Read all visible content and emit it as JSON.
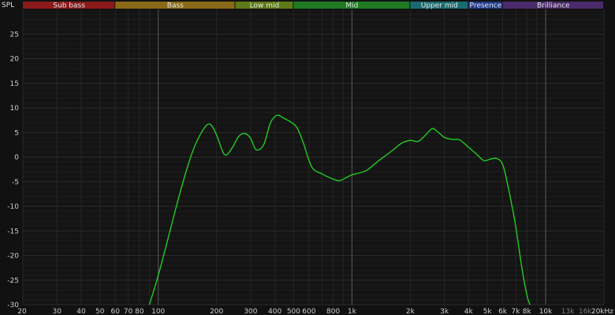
{
  "chart_data": {
    "type": "line",
    "ylabel": "SPL",
    "xscale": "log",
    "xlim": [
      20,
      20000
    ],
    "ylim": [
      -30,
      30
    ],
    "grid": true,
    "y_ticks": [
      {
        "value": 25,
        "label": "25"
      },
      {
        "value": 20,
        "label": "20"
      },
      {
        "value": 15,
        "label": "15"
      },
      {
        "value": 10,
        "label": "10"
      },
      {
        "value": 5,
        "label": "5"
      },
      {
        "value": 0,
        "label": "0"
      },
      {
        "value": -5,
        "label": "-5"
      },
      {
        "value": -10,
        "label": "-10"
      },
      {
        "value": -15,
        "label": "-15"
      },
      {
        "value": -20,
        "label": "-20"
      },
      {
        "value": -25,
        "label": "-25"
      },
      {
        "value": -30,
        "label": "-30"
      }
    ],
    "x_ticks": [
      {
        "value": 20,
        "label": "20"
      },
      {
        "value": 30,
        "label": "30"
      },
      {
        "value": 40,
        "label": "40"
      },
      {
        "value": 50,
        "label": "50"
      },
      {
        "value": 60,
        "label": "60"
      },
      {
        "value": 70,
        "label": "70"
      },
      {
        "value": 80,
        "label": "80"
      },
      {
        "value": 100,
        "label": "100"
      },
      {
        "value": 200,
        "label": "200"
      },
      {
        "value": 300,
        "label": "300"
      },
      {
        "value": 400,
        "label": "400"
      },
      {
        "value": 500,
        "label": "500"
      },
      {
        "value": 600,
        "label": "600"
      },
      {
        "value": 800,
        "label": "800"
      },
      {
        "value": 1000,
        "label": "1k"
      },
      {
        "value": 2000,
        "label": "2k"
      },
      {
        "value": 3000,
        "label": "3k"
      },
      {
        "value": 4000,
        "label": "4k"
      },
      {
        "value": 5000,
        "label": "5k"
      },
      {
        "value": 6000,
        "label": "6k"
      },
      {
        "value": 7000,
        "label": "7k"
      },
      {
        "value": 8000,
        "label": "8k"
      },
      {
        "value": 10000,
        "label": "10k"
      },
      {
        "value": 13000,
        "label": "13k",
        "dim": true
      },
      {
        "value": 16000,
        "label": "16k",
        "dim": true
      },
      {
        "value": 20000,
        "label": "20kHz"
      }
    ],
    "major_grid_x": [
      100,
      1000,
      10000
    ],
    "bands": [
      {
        "name": "Sub bass",
        "from": 20,
        "to": 60,
        "color": "#8b1a1a"
      },
      {
        "name": "Bass",
        "from": 60,
        "to": 250,
        "color": "#8a6a16"
      },
      {
        "name": "Low mid",
        "from": 250,
        "to": 500,
        "color": "#5e7a16"
      },
      {
        "name": "Mid",
        "from": 500,
        "to": 2000,
        "color": "#1f7a22"
      },
      {
        "name": "Upper mid",
        "from": 2000,
        "to": 4000,
        "color": "#1a6b70"
      },
      {
        "name": "Presence",
        "from": 4000,
        "to": 6000,
        "color": "#1f3a8a"
      },
      {
        "name": "Brilliance",
        "from": 6000,
        "to": 20000,
        "color": "#4a2a6a"
      }
    ],
    "series": [
      {
        "color": "#22cc22",
        "x": [
          90,
          100,
          115,
          130,
          150,
          170,
          185,
          200,
          220,
          240,
          260,
          280,
          300,
          320,
          350,
          380,
          410,
          440,
          480,
          520,
          560,
          620,
          700,
          780,
          860,
          930,
          1000,
          1100,
          1200,
          1300,
          1400,
          1600,
          1800,
          2000,
          2200,
          2400,
          2600,
          2800,
          3000,
          3300,
          3600,
          4000,
          4400,
          4800,
          5200,
          5600,
          6000,
          6400,
          7000,
          7500,
          8000,
          8300
        ],
        "y": [
          -30,
          -24,
          -15,
          -7,
          1,
          5.5,
          6.7,
          4.5,
          0.5,
          1.8,
          4.2,
          4.8,
          3.8,
          1.5,
          2.5,
          7.0,
          8.5,
          8.0,
          7.2,
          6.0,
          3.0,
          -2.0,
          -3.4,
          -4.3,
          -4.8,
          -4.2,
          -3.6,
          -3.2,
          -2.6,
          -1.5,
          -0.5,
          1.2,
          2.8,
          3.4,
          3.2,
          4.5,
          5.8,
          5.0,
          4.0,
          3.6,
          3.5,
          2.0,
          0.6,
          -0.7,
          -0.4,
          -0.3,
          -1.5,
          -6,
          -14,
          -22,
          -28,
          -30
        ]
      }
    ]
  }
}
